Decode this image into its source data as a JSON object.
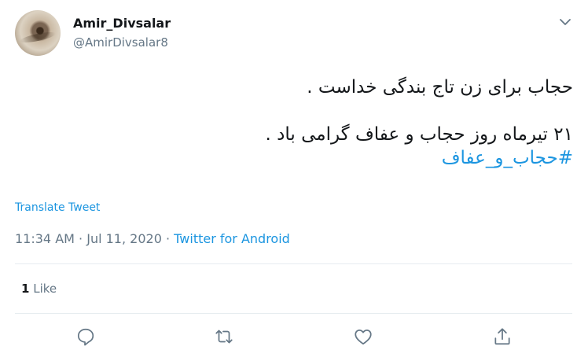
{
  "author": {
    "display_name": "Amir_Divsalar",
    "handle": "@AmirDivsalar8"
  },
  "tweet": {
    "line1": "حجاب برای زن تاج بندگی خداست .",
    "line2": "۲۱ تیرماه روز حجاب و عفاف گرامی باد .",
    "hashtag": "#حجاب_و_عفاف"
  },
  "translate_label": "Translate Tweet",
  "meta": {
    "time": "11:34 AM",
    "separator": "·",
    "date": "Jul 11, 2020",
    "source": "Twitter for Android"
  },
  "stats": {
    "likes_count": "1",
    "likes_label": "Like"
  },
  "actions": [
    {
      "icon": "reply-icon"
    },
    {
      "icon": "retweet-icon"
    },
    {
      "icon": "like-icon"
    },
    {
      "icon": "share-icon"
    }
  ],
  "colors": {
    "link": "#1b95e0",
    "secondary_text": "#657786",
    "primary_text": "#14171a",
    "divider": "#e6ecf0"
  }
}
